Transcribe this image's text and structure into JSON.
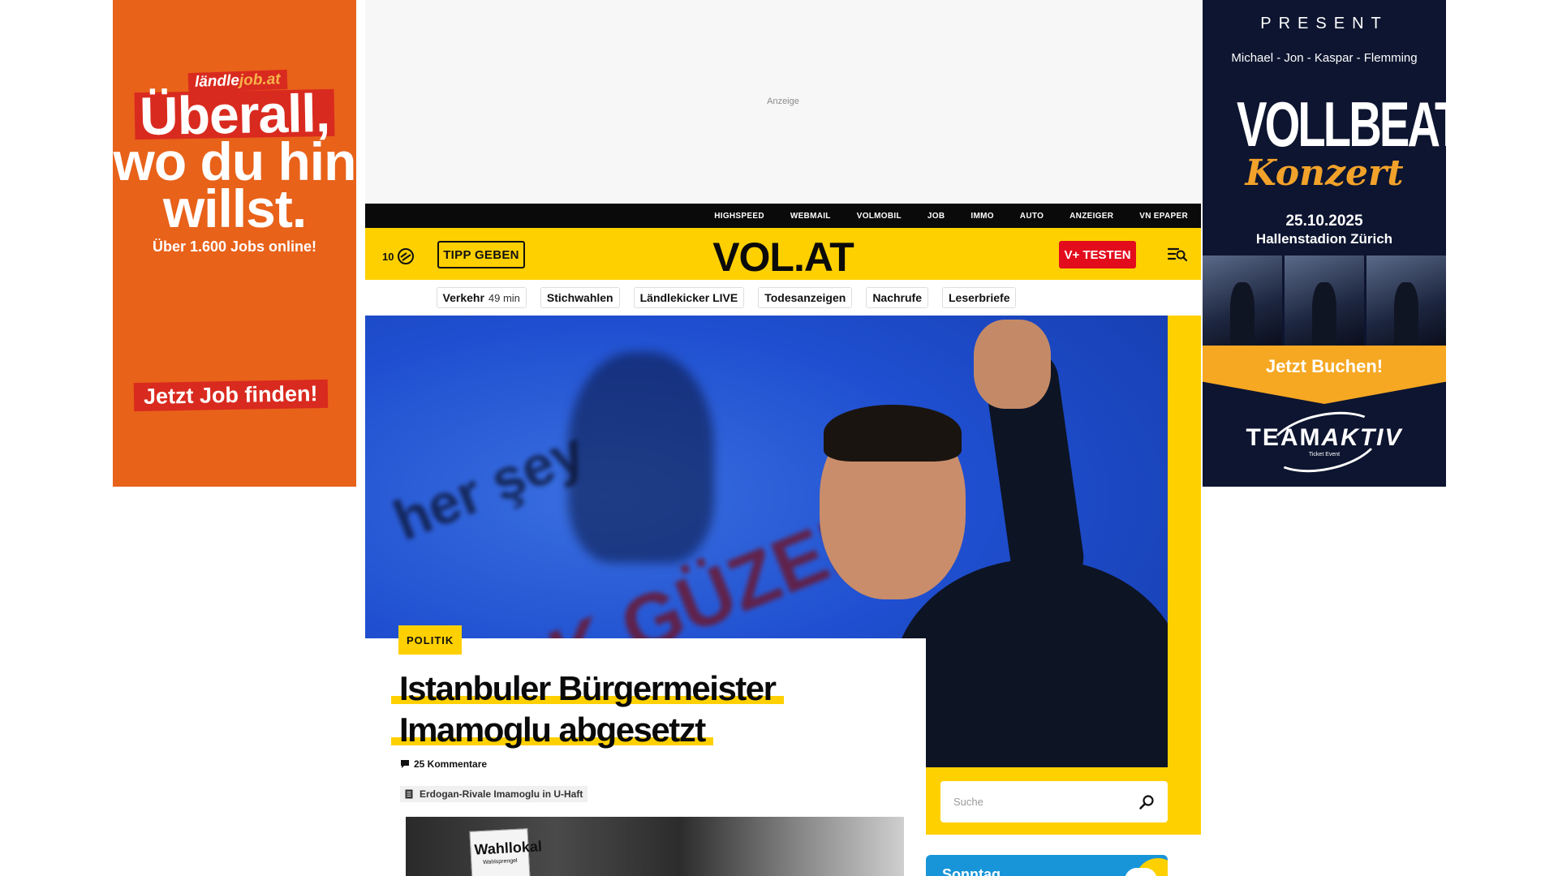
{
  "ads": {
    "left": {
      "brand_a": "ländle",
      "brand_b": "job.at",
      "headline_lines": [
        "Überall,",
        "wo du hin",
        "willst."
      ],
      "subline": "Über 1.600 Jobs online!",
      "cta": "Jetzt Job finden!"
    },
    "right": {
      "present": "PRESENT",
      "names": "Michael - Jon - Kaspar - Flemming",
      "band": "VOLLBEAT",
      "event": "Konzert",
      "date": "25.10.2025",
      "venue": "Hallenstadion Zürich",
      "cta": "Jetzt Buchen!",
      "organizer_a": "TEAM",
      "organizer_b": "AKTIV",
      "organizer_sub": "Ticket Event"
    },
    "billboard_label": "Anzeige"
  },
  "service_links": [
    "HIGHSPEED",
    "WEBMAIL",
    "VOLMOBIL",
    "JOB",
    "IMMO",
    "AUTO",
    "ANZEIGER",
    "VN EPAPER"
  ],
  "header": {
    "temperature": "10",
    "weather_icon": "sun-icon",
    "tipp_label": "TIPP GEBEN",
    "logo": "VOL.AT",
    "vplus_label": "V+ TESTEN",
    "menu_icon": "search-menu-icon"
  },
  "quick_links": [
    {
      "label": "Verkehr",
      "extra": "49 min"
    },
    {
      "label": "Stichwahlen",
      "extra": ""
    },
    {
      "label": "Ländlekicker LIVE",
      "extra": ""
    },
    {
      "label": "Todesanzeigen",
      "extra": ""
    },
    {
      "label": "Nachrufe",
      "extra": ""
    },
    {
      "label": "Leserbriefe",
      "extra": ""
    }
  ],
  "hero": {
    "category": "POLITIK",
    "title_lines": [
      "Istanbuler Bürgermeister",
      "Imamoglu abgesetzt"
    ],
    "comments": "25 Kommentare",
    "related": "Erdogan-Rivale Imamoglu in U-Haft",
    "image_text_1": "her şey",
    "image_text_2": "ÇOK GÜZEL",
    "thumb_sign": "Wahllokal",
    "thumb_sign_small": "Wahlsprengel"
  },
  "search": {
    "placeholder": "Suche"
  },
  "weather": {
    "day": "Sonntag"
  }
}
